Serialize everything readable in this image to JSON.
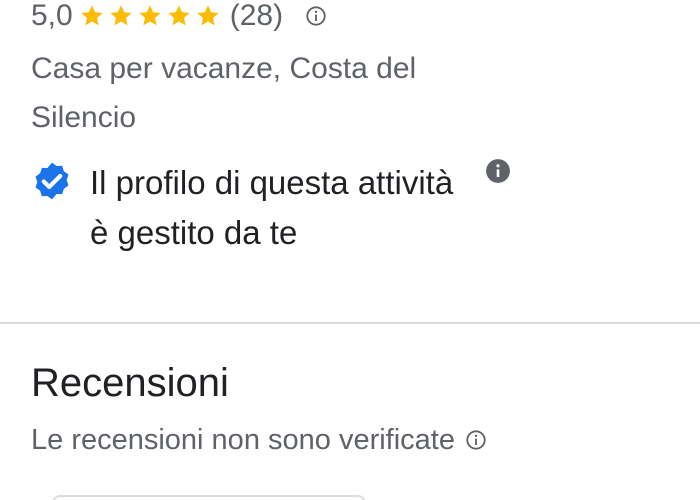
{
  "rating": {
    "value": "5,0",
    "stars": 5,
    "stars_filled": 5,
    "count": "(28)",
    "star_color": "#fbbc04"
  },
  "place": {
    "category": "Casa per vacanze, Costa del Silencio"
  },
  "verified": {
    "text": "Il profilo di questa attività è gestito da te",
    "badge_color": "#1a73e8"
  },
  "reviews": {
    "title": "Recensioni",
    "subtitle": "Le recensioni non sono verificate"
  },
  "colors": {
    "primary_text": "#202124",
    "secondary_text": "#5f6368",
    "divider": "#dadce0"
  }
}
